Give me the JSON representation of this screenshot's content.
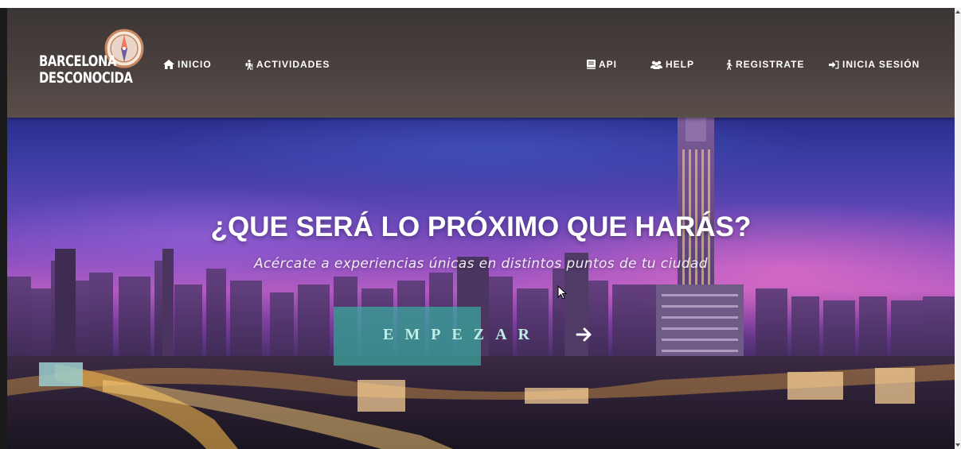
{
  "brand": {
    "line1": "BARCELONA",
    "line2": "DESCONOCIDA",
    "logo_icon": "compass-icon"
  },
  "nav": {
    "left": [
      {
        "label": "INICIO",
        "icon": "home-icon"
      },
      {
        "label": "ACTIVIDADES",
        "icon": "hiking-icon"
      }
    ],
    "right": [
      {
        "label": "API",
        "icon": "book-icon"
      },
      {
        "label": "HELP",
        "icon": "users-icon"
      },
      {
        "label": "REGISTRATE",
        "icon": "walking-person-icon"
      },
      {
        "label": "INICIA SESIÓN",
        "icon": "sign-in-icon"
      }
    ]
  },
  "hero": {
    "title": "¿QUE SERÁ LO PRÓXIMO QUE HARÁS?",
    "subtitle": "Acércate a experiencias únicas en distintos puntos de tu ciudad",
    "cta_label": "EMPEZAR",
    "cta_icon": "arrow-right-icon"
  },
  "colors": {
    "navbar": "#4a413f",
    "cta_background": "#39aaa0",
    "cta_text": "#bfeee6",
    "text": "#ffffff"
  }
}
